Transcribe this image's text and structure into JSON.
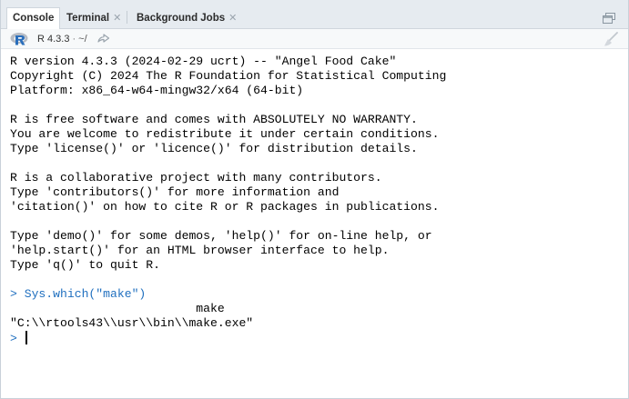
{
  "tabs": [
    {
      "label": "Console",
      "closable": false,
      "active": true
    },
    {
      "label": "Terminal",
      "closable": true,
      "active": false
    },
    {
      "label": "Background Jobs",
      "closable": true,
      "active": false
    }
  ],
  "toolbar": {
    "r_version": "R 4.3.3",
    "separator": "·",
    "path": "~/",
    "icons": [
      "r-logo-icon",
      "share-arrow-icon",
      "broom-icon",
      "maximize-icon"
    ]
  },
  "console": {
    "banner": [
      "R version 4.3.3 (2024-02-29 ucrt) -- \"Angel Food Cake\"",
      "Copyright (C) 2024 The R Foundation for Statistical Computing",
      "Platform: x86_64-w64-mingw32/x64 (64-bit)",
      "",
      "R is free software and comes with ABSOLUTELY NO WARRANTY.",
      "You are welcome to redistribute it under certain conditions.",
      "Type 'license()' or 'licence()' for distribution details.",
      "",
      "R is a collaborative project with many contributors.",
      "Type 'contributors()' for more information and",
      "'citation()' on how to cite R or R packages in publications.",
      "",
      "Type 'demo()' for some demos, 'help()' for on-line help, or",
      "'help.start()' for an HTML browser interface to help.",
      "Type 'q()' to quit R.",
      ""
    ],
    "command": "> Sys.which(\"make\")",
    "output_name": "                          make",
    "output_value": "\"C:\\\\rtools43\\\\usr\\\\bin\\\\make.exe\"",
    "prompt": "> "
  },
  "colors": {
    "input": "#1f6fbf",
    "tabbar_bg": "#e6ebf0"
  }
}
